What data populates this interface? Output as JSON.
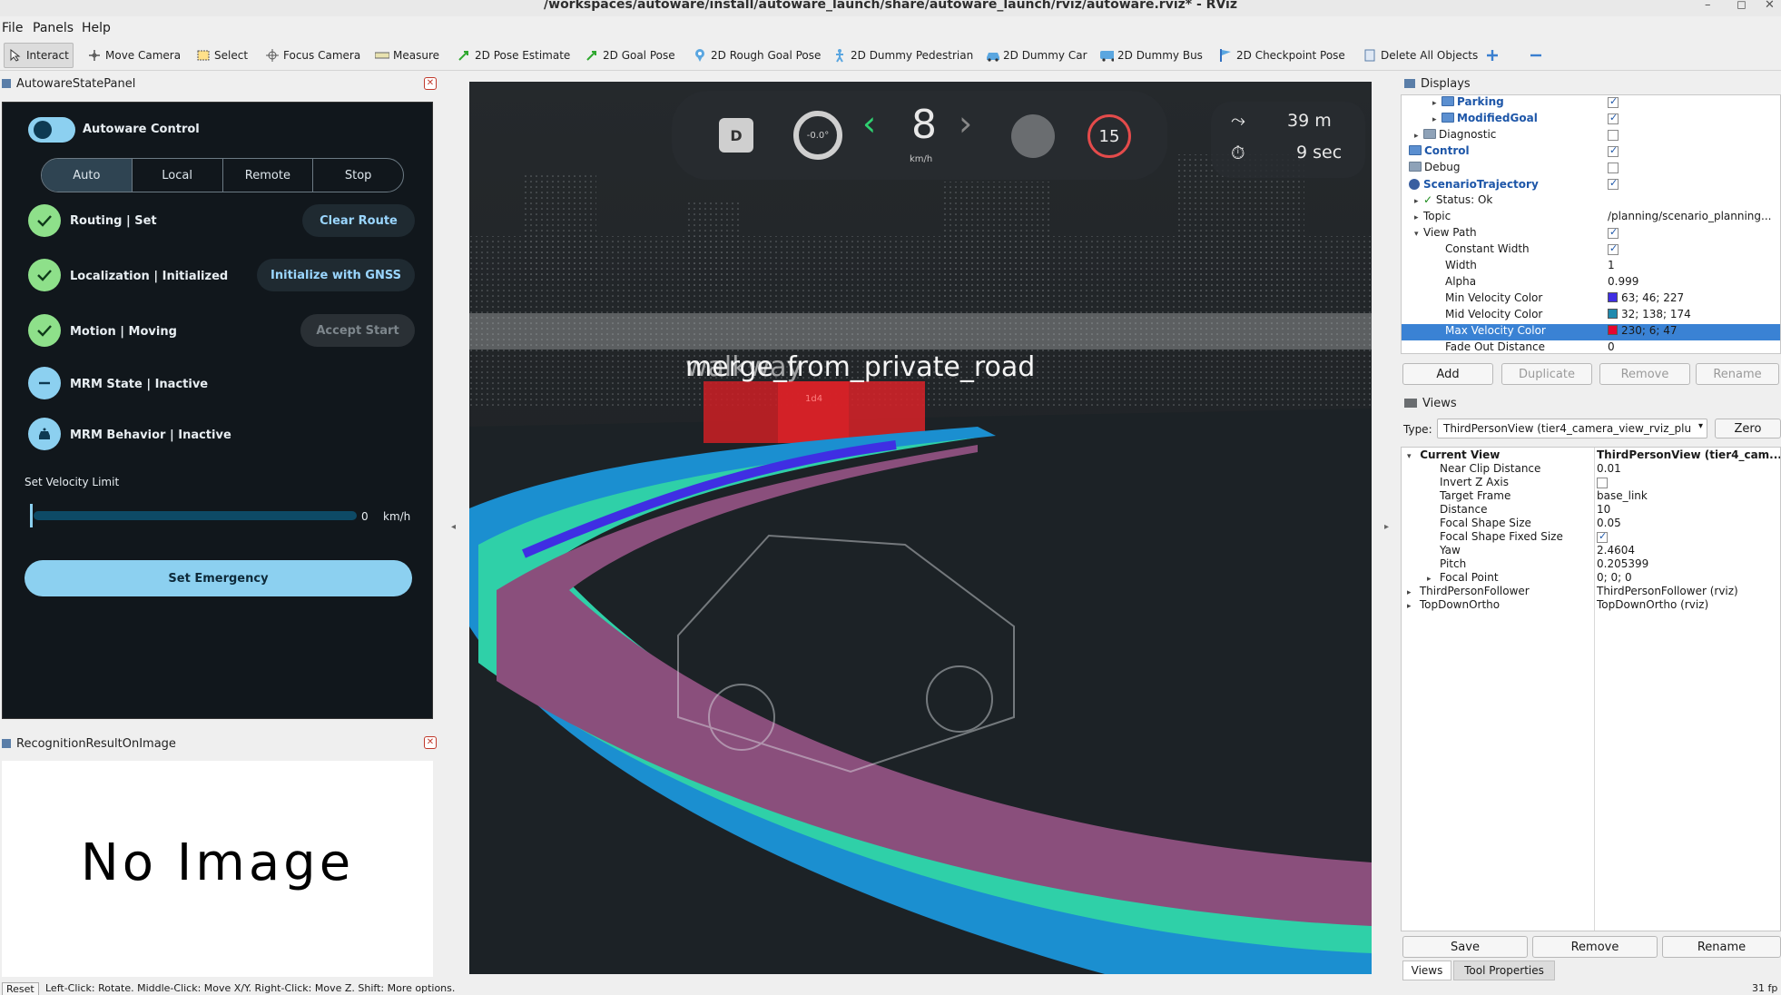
{
  "window": {
    "title": "/workspaces/autoware/install/autoware_launch/share/autoware_launch/rviz/autoware.rviz* - RViz"
  },
  "menu": [
    "File",
    "Panels",
    "Help"
  ],
  "toolbar": {
    "tools": [
      {
        "label": "Interact",
        "icon": "cursor-icon"
      },
      {
        "label": "Move Camera",
        "icon": "move-icon"
      },
      {
        "label": "Select",
        "icon": "select-box-icon"
      },
      {
        "label": "Focus Camera",
        "icon": "focus-icon"
      },
      {
        "label": "Measure",
        "icon": "ruler-icon"
      },
      {
        "label": "2D Pose Estimate",
        "icon": "green-arrow-icon"
      },
      {
        "label": "2D Goal Pose",
        "icon": "green-arrow-icon"
      },
      {
        "label": "2D Rough Goal Pose",
        "icon": "pin-icon"
      },
      {
        "label": "2D Dummy Pedestrian",
        "icon": "pedestrian-icon"
      },
      {
        "label": "2D Dummy Car",
        "icon": "car-icon"
      },
      {
        "label": "2D Dummy Bus",
        "icon": "bus-icon"
      },
      {
        "label": "2D Checkpoint Pose",
        "icon": "flag-icon"
      },
      {
        "label": "Delete All Objects",
        "icon": "delete-icon"
      }
    ]
  },
  "autoware_panel": {
    "title": "AutowareStatePanel",
    "control_label": "Autoware Control",
    "modes": [
      "Auto",
      "Local",
      "Remote",
      "Stop"
    ],
    "routing": "Routing | Set",
    "clear_route": "Clear Route",
    "localization": "Localization | Initialized",
    "init_gnss": "Initialize with GNSS",
    "motion": "Motion | Moving",
    "accept_start": "Accept Start",
    "mrm_state": "MRM State | Inactive",
    "mrm_behavior": "MRM Behavior | Inactive",
    "velocity_label": "Set Velocity Limit",
    "velocity_value": "0",
    "velocity_unit": "km/h",
    "emergency": "Set Emergency"
  },
  "recognition_panel": {
    "title": "RecognitionResultOnImage",
    "placeholder": "No Image"
  },
  "viewport": {
    "gear": "D",
    "steering": "-0.0°",
    "speed": "8",
    "speed_unit": "km/h",
    "speed_limit": "15",
    "distance": "39 m",
    "time": "9 sec",
    "overlay_text_a": "merge_from_private_road",
    "overlay_text_b": "walkway",
    "obstacle_label": "1d4"
  },
  "displays": {
    "title": "Displays",
    "rows": [
      {
        "key": "Parking",
        "link": true,
        "indent": 2,
        "check": true
      },
      {
        "key": "ModifiedGoal",
        "link": true,
        "indent": 2,
        "check": true
      },
      {
        "key": "Diagnostic",
        "indent": 1,
        "check": false
      },
      {
        "key": "Control",
        "link": true,
        "indent": 0,
        "check": true
      },
      {
        "key": "Debug",
        "indent": 0,
        "check": false
      },
      {
        "key": "ScenarioTrajectory",
        "link": true,
        "indent": 0,
        "check": true
      },
      {
        "key": "Status: Ok",
        "indent": 1,
        "value": ""
      },
      {
        "key": "Topic",
        "indent": 1,
        "value": "/planning/scenario_planning..."
      },
      {
        "key": "View Path",
        "indent": 1,
        "check": true
      },
      {
        "key": "Constant Width",
        "indent": 2,
        "check": true
      },
      {
        "key": "Width",
        "indent": 2,
        "value": "1"
      },
      {
        "key": "Alpha",
        "indent": 2,
        "value": "0.999"
      },
      {
        "key": "Min Velocity Color",
        "indent": 2,
        "value": "63; 46; 227",
        "color": "#3f2ee3"
      },
      {
        "key": "Mid Velocity Color",
        "indent": 2,
        "value": "32; 138; 174",
        "color": "#208aae"
      },
      {
        "key": "Max Velocity Color",
        "indent": 2,
        "value": "230; 6; 47",
        "color": "#e6062f",
        "selected": true
      },
      {
        "key": "Fade Out Distance",
        "indent": 2,
        "value": "0"
      }
    ],
    "buttons": [
      "Add",
      "Duplicate",
      "Remove",
      "Rename"
    ]
  },
  "views": {
    "title": "Views",
    "type_label": "Type:",
    "type_value": "ThirdPersonView (tier4_camera_view_rviz_plu",
    "zero": "Zero",
    "rows": [
      {
        "key": "Current View",
        "value": "ThirdPersonView (tier4_cam...",
        "bold": true,
        "indent": 0
      },
      {
        "key": "Near Clip Distance",
        "value": "0.01",
        "indent": 2
      },
      {
        "key": "Invert Z Axis",
        "value": "",
        "indent": 2,
        "check": false
      },
      {
        "key": "Target Frame",
        "value": "base_link",
        "indent": 2
      },
      {
        "key": "Distance",
        "value": "10",
        "indent": 2
      },
      {
        "key": "Focal Shape Size",
        "value": "0.05",
        "indent": 2
      },
      {
        "key": "Focal Shape Fixed Size",
        "value": "",
        "indent": 2,
        "check": true
      },
      {
        "key": "Yaw",
        "value": "2.4604",
        "indent": 2
      },
      {
        "key": "Pitch",
        "value": "0.205399",
        "indent": 2
      },
      {
        "key": "Focal Point",
        "value": "0; 0; 0",
        "indent": 1
      },
      {
        "key": "ThirdPersonFollower",
        "value": "ThirdPersonFollower (rviz)",
        "indent": 0
      },
      {
        "key": "TopDownOrtho",
        "value": "TopDownOrtho (rviz)",
        "indent": 0
      }
    ],
    "buttons": [
      "Save",
      "Remove",
      "Rename"
    ],
    "tabs": [
      "Views",
      "Tool Properties"
    ]
  },
  "statusbar": {
    "reset": "Reset",
    "hint": "Left-Click: Rotate.  Middle-Click: Move X/Y.  Right-Click: Move Z.  Shift: More options.",
    "fps": "31 fp"
  }
}
